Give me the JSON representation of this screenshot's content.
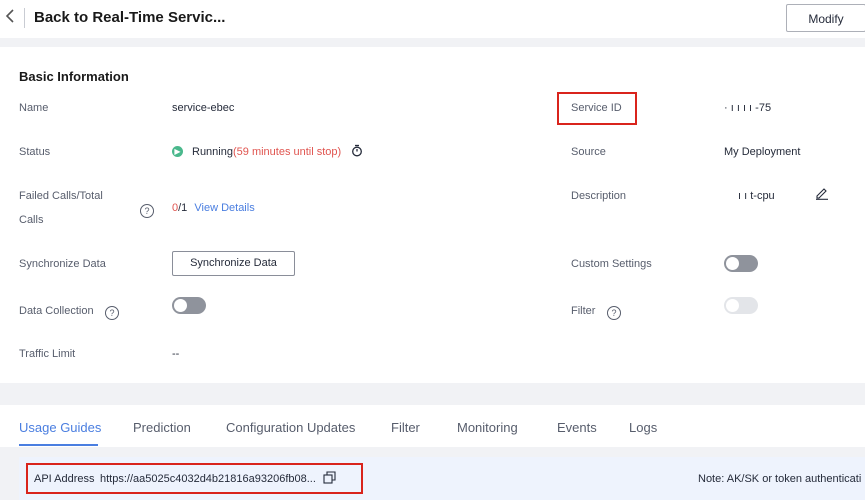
{
  "header": {
    "back_icon": "chevron-left-icon",
    "title": "Back to Real-Time Servic...",
    "modify_label": "Modify"
  },
  "basic": {
    "section_title": "Basic Information",
    "name_label": "Name",
    "name_value": "service-ebec",
    "service_id_label": "Service ID",
    "service_id_value": "·  ı   ı   ı   ı   -75",
    "status_label": "Status",
    "status_value": "Running",
    "status_note": "(59 minutes until stop)",
    "source_label": "Source",
    "source_value": "My Deployment",
    "failed_calls_label_1": "Failed Calls/Total",
    "failed_calls_label_2": "Calls",
    "failed_calls_failed": "0",
    "failed_calls_total": "/1",
    "view_details": "View Details",
    "description_label": "Description",
    "description_value": "ı    ı   t-cpu",
    "sync_label": "Synchronize Data",
    "sync_button": "Synchronize Data",
    "custom_settings_label": "Custom Settings",
    "data_collection_label": "Data Collection",
    "filter_label": "Filter",
    "traffic_limit_label": "Traffic Limit",
    "traffic_limit_value": "--",
    "toggles": {
      "custom_settings": false,
      "data_collection": false,
      "filter": false
    }
  },
  "tabs": [
    "Usage Guides",
    "Prediction",
    "Configuration Updates",
    "Filter",
    "Monitoring",
    "Events",
    "Logs"
  ],
  "active_tab": "Usage Guides",
  "api": {
    "label": "API Address",
    "url": "https://aa5025c4032d4b21816a93206fb08...",
    "copy_icon": "copy-icon",
    "note": "Note: AK/SK or token authenticati"
  },
  "colors": {
    "accent": "#4a7ee0",
    "highlight_box": "#d9241c",
    "running": "#4ab88c",
    "warning_text": "#e0544f"
  }
}
